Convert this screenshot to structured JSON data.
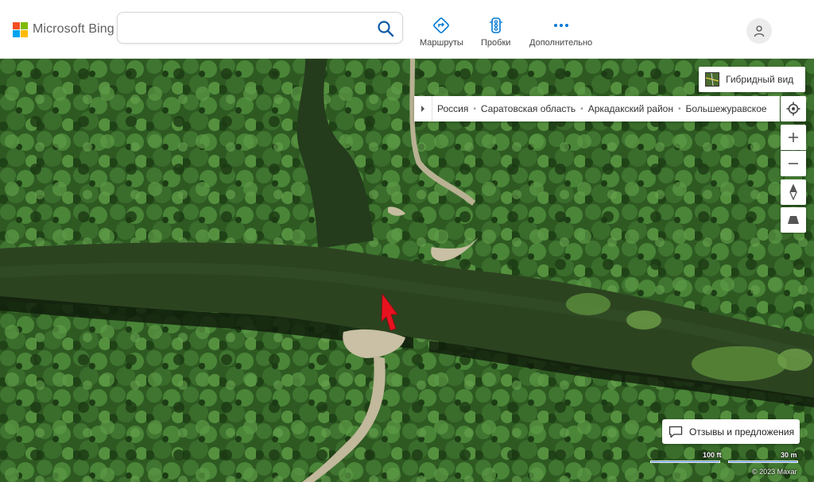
{
  "header": {
    "logo_text": "Microsoft Bing",
    "logo_colors": [
      "#f25022",
      "#7fba00",
      "#00a4ef",
      "#ffb900"
    ],
    "search": {
      "value": "",
      "placeholder": ""
    },
    "nav": [
      {
        "label": "Маршруты",
        "icon": "directions-icon"
      },
      {
        "label": "Пробки",
        "icon": "traffic-light-icon"
      },
      {
        "label": "Дополнительно",
        "icon": "more-dots-icon"
      }
    ],
    "accent_color": "#0078d4"
  },
  "map": {
    "view_toggle_label": "Гибридный вид",
    "breadcrumb": [
      "Россия",
      "Саратовская область",
      "Аркадакский район",
      "Большежуравское"
    ],
    "breadcrumb_separator": "•",
    "feedback_label": "Отзывы и предложения",
    "scale": {
      "imperial": "100 ft",
      "metric": "30 m"
    },
    "copyright": "© 2023 Maxar",
    "pin_color": "#e8121f"
  }
}
